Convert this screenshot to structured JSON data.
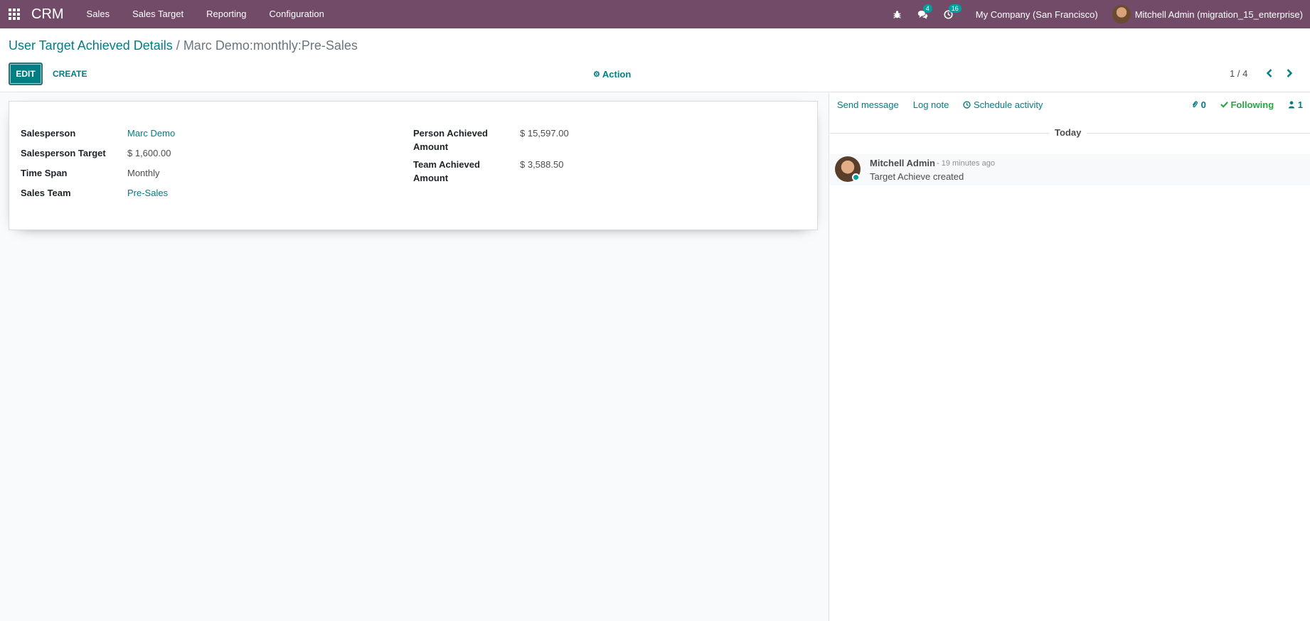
{
  "navbar": {
    "app_name": "CRM",
    "menu": [
      "Sales",
      "Sales Target",
      "Reporting",
      "Configuration"
    ],
    "messages_count": "4",
    "activities_count": "16",
    "company": "My Company (San Francisco)",
    "user": "Mitchell Admin (migration_15_enterprise)",
    "colors": {
      "bar": "#714b67",
      "badge": "#00a09d"
    }
  },
  "control": {
    "breadcrumb_parent": "User Target Achieved Details",
    "breadcrumb_separator": "/",
    "breadcrumb_current": "Marc Demo:monthly:Pre-Sales",
    "edit_label": "EDIT",
    "create_label": "CREATE",
    "action_label": "Action",
    "pager": "1 / 4"
  },
  "form": {
    "left": [
      {
        "label": "Salesperson",
        "value": "Marc Demo"
      },
      {
        "label": "Salesperson Target",
        "value": "$ 1,600.00"
      },
      {
        "label": "Time Span",
        "value": "Monthly"
      },
      {
        "label": "Sales Team",
        "value": "Pre-Sales"
      }
    ],
    "right": [
      {
        "label_line1": "Person Achieved",
        "label_line2": "Amount",
        "value": "$ 15,597.00"
      },
      {
        "label_line1": "Team Achieved",
        "label_line2": "Amount",
        "value": "$ 3,588.50"
      }
    ]
  },
  "chatter": {
    "send_message": "Send message",
    "log_note": "Log note",
    "schedule_activity": "Schedule activity",
    "attachments": "0",
    "following": "Following",
    "followers": "1",
    "date_separator": "Today",
    "message": {
      "author": "Mitchell Admin",
      "time": "- 19 minutes ago",
      "body": "Target Achieve created"
    }
  }
}
